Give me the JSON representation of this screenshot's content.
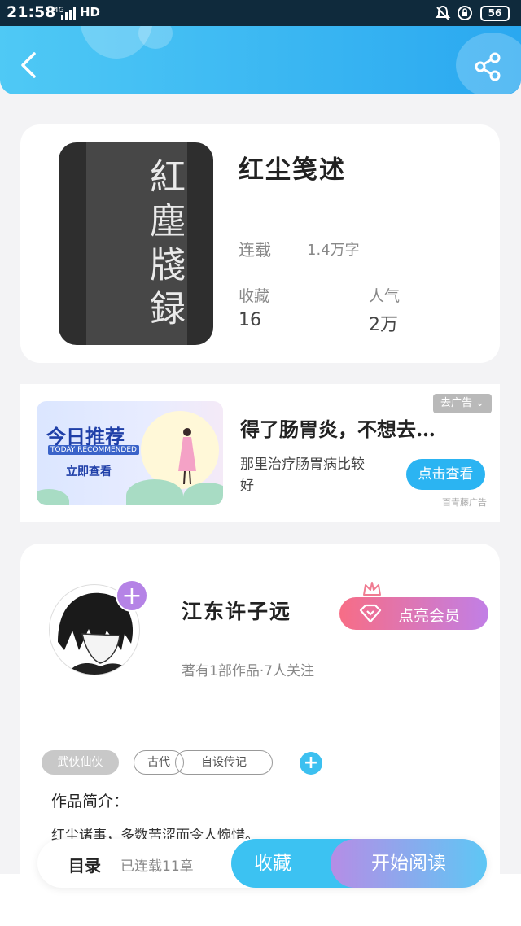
{
  "status_bar": {
    "time": "21:58",
    "network": "4G",
    "signal": "signal-bars-icon",
    "hd": "HD",
    "battery": "56"
  },
  "header": {
    "back": "back-arrow-icon",
    "share": "share-icon"
  },
  "book": {
    "cover_text": "紅塵牋録",
    "title": "红尘笺述",
    "status": "连载",
    "words": "1.4万字",
    "stats": [
      {
        "label": "收藏",
        "value": "16"
      },
      {
        "label": "人气",
        "value": "2万"
      }
    ]
  },
  "ad": {
    "image_title": "今日推荐",
    "image_subtitle": "TODAY RECOMMENDED",
    "image_button": "立即查看",
    "close_label": "去广告",
    "title": "得了肠胃炎，不想去…",
    "description": "那里治疗肠胃病比较好",
    "button": "点击查看",
    "source": "百青藤广告"
  },
  "author": {
    "name": "江东许子远",
    "meta": "著有1部作品·7人关注",
    "vip_button": "点亮会员",
    "tags": [
      "武侠仙侠",
      "古代",
      "自设传记"
    ],
    "intro_title": "作品简介：",
    "intro_text": "红尘诸事，多数苦涩而令人惋惜。"
  },
  "bottom_bar": {
    "toc": "目录",
    "chapters": "已连载11章",
    "favorite": "收藏",
    "read": "开始阅读"
  },
  "colors": {
    "accent": "#2aa8f0",
    "vip": "#f76d86",
    "purple": "#b583e6"
  }
}
